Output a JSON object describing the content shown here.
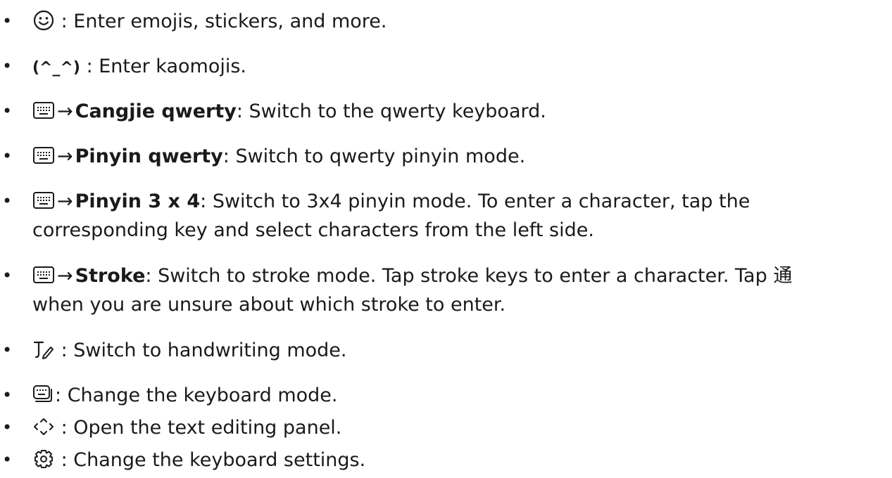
{
  "items": [
    {
      "icon": "emoji-icon",
      "sep": " : ",
      "text": "Enter emojis, stickers, and more."
    },
    {
      "kaomoji": "(^_^)",
      "sep": " : ",
      "text": "Enter kaomojis."
    },
    {
      "icon": "keyboard-icon",
      "arrow": "→",
      "label": "Cangjie qwerty",
      "text": ": Switch to the qwerty keyboard."
    },
    {
      "icon": "keyboard-icon",
      "arrow": "→",
      "label": "Pinyin qwerty",
      "text": ": Switch to qwerty pinyin mode."
    },
    {
      "icon": "keyboard-icon",
      "arrow": "→",
      "label": "Pinyin 3 x 4",
      "text": ": Switch to 3x4 pinyin mode. To enter a character, tap the",
      "text2": "corresponding key and select characters from the left side."
    },
    {
      "icon": "keyboard-icon",
      "arrow": "→",
      "label": "Stroke",
      "text": ": Switch to stroke mode. Tap stroke keys to enter a character. Tap ",
      "cjk": "通",
      "text2": "when you are unsure about which stroke to enter."
    },
    {
      "icon": "handwriting-icon",
      "sep": " : ",
      "text": "Switch to handwriting mode."
    },
    {
      "icon": "keyboard-mode-icon",
      "sep": ": ",
      "text": "Change the keyboard mode."
    },
    {
      "icon": "text-editing-icon",
      "sep": " : ",
      "text": "Open the text editing panel."
    },
    {
      "icon": "settings-gear-icon",
      "sep": " : ",
      "text": "Change the keyboard settings."
    }
  ],
  "bullet": "•"
}
